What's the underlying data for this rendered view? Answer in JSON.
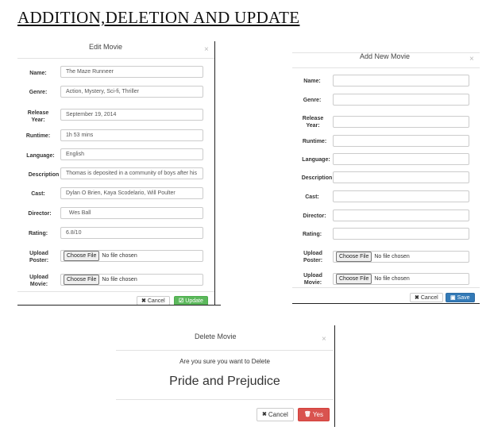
{
  "page": {
    "title": "ADDITION,DELETION AND UPDATE"
  },
  "edit_modal": {
    "title": "Edit Movie",
    "close": "×",
    "labels": {
      "name": "Name:",
      "genre": "Genre:",
      "release_year": "Release Year:",
      "runtime": "Runtime:",
      "language": "Language:",
      "description": "Description",
      "cast": "Cast:",
      "director": "Director:",
      "rating": "Rating:",
      "upload_poster": "Upload Poster:",
      "upload_movie": "Upload Movie:"
    },
    "values": {
      "name": "The Maze Runneer",
      "genre": "Action, Mystery, Sci-fi, Thriller",
      "release_year": "September 19, 2014",
      "runtime": "1h 53 mins",
      "language": "English",
      "description": "Thomas is deposited in a community of boys after his",
      "cast": " Dylan O Brien, Kaya Scodelario, Will Poulter",
      "director": "  Wes Ball",
      "rating": "6.8/10"
    },
    "file": {
      "choose": "Choose File",
      "none": "No file chosen"
    },
    "buttons": {
      "cancel": "Cancel",
      "update": "Update"
    }
  },
  "add_modal": {
    "title": "Add New Movie",
    "close": "×",
    "labels": {
      "name": "Name:",
      "genre": "Genre:",
      "release_year": "Release Year:",
      "runtime": "Runtime:",
      "language": "Language:",
      "description": "Description",
      "cast": "Cast:",
      "director": "Director:",
      "rating": "Rating:",
      "upload_poster": "Upload Poster:",
      "upload_movie": "Upload Movie:"
    },
    "file": {
      "choose": "Choose File",
      "none": "No file chosen"
    },
    "buttons": {
      "cancel": "Cancel",
      "save": "Save"
    }
  },
  "delete_modal": {
    "title": "Delete Movie",
    "close": "×",
    "prompt": "Are you sure you want to Delete",
    "movie": "Pride and Prejudice",
    "buttons": {
      "cancel": "Cancel",
      "yes": "Yes"
    }
  },
  "icons": {
    "cancel": "✖",
    "update": "☑",
    "save": "▣",
    "delete": "🗑"
  }
}
